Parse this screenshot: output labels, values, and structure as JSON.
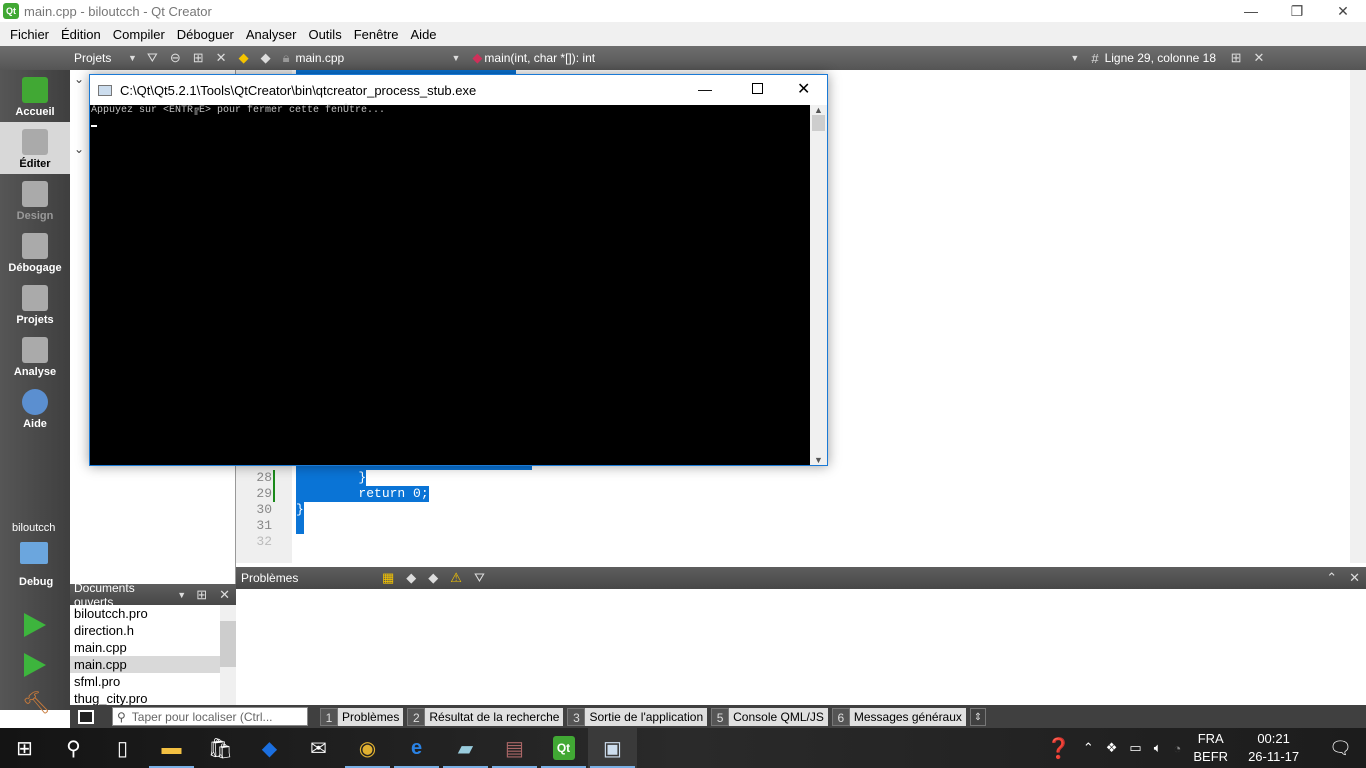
{
  "window": {
    "title": "main.cpp - biloutcch - Qt Creator",
    "minimize": "—",
    "restore": "❐",
    "close": "✕"
  },
  "menu": [
    "Fichier",
    "Édition",
    "Compiler",
    "Déboguer",
    "Analyser",
    "Outils",
    "Fenêtre",
    "Aide"
  ],
  "toolbar": {
    "projects_label": "Projets",
    "file": "main.cpp",
    "symbol": "main(int, char *[]): int",
    "position": "Ligne 29, colonne 18"
  },
  "modes": [
    {
      "label": "Accueil",
      "icon": "qt-logo-icon"
    },
    {
      "label": "Éditer",
      "icon": "edit-icon"
    },
    {
      "label": "Design",
      "icon": "design-icon"
    },
    {
      "label": "Débogage",
      "icon": "debug-icon"
    },
    {
      "label": "Projets",
      "icon": "projects-icon"
    },
    {
      "label": "Analyse",
      "icon": "analyze-icon"
    },
    {
      "label": "Aide",
      "icon": "help-icon"
    }
  ],
  "kit": {
    "project": "biloutcch",
    "config": "Debug"
  },
  "editor": {
    "lines": [
      {
        "n": "28",
        "code": "        }"
      },
      {
        "n": "29",
        "code": "        return 0;"
      },
      {
        "n": "30",
        "code": "}"
      },
      {
        "n": "31",
        "code": " "
      },
      {
        "n": "32",
        "code": ""
      }
    ]
  },
  "console": {
    "title": "C:\\Qt\\Qt5.2.1\\Tools\\QtCreator\\bin\\qtcreator_process_stub.exe",
    "text": "Appuyez sur <ENTR╔E> pour fermer cette fenÛtre..."
  },
  "open_docs": {
    "title": "Documents ouverts",
    "items": [
      "biloutcch.pro",
      "direction.h",
      "main.cpp",
      "main.cpp",
      "sfml.pro",
      "thug_city.pro"
    ],
    "selected": 3
  },
  "problems": {
    "title": "Problèmes"
  },
  "statusbar": {
    "search_placeholder": "Taper pour localiser (Ctrl...",
    "tabs": [
      {
        "n": "1",
        "label": "Problèmes"
      },
      {
        "n": "2",
        "label": "Résultat de la recherche"
      },
      {
        "n": "3",
        "label": "Sortie de l'application"
      },
      {
        "n": "5",
        "label": "Console QML/JS"
      },
      {
        "n": "6",
        "label": "Messages généraux"
      }
    ]
  },
  "taskbar": {
    "lang": "FRA",
    "layout": "BEFR",
    "time": "00:21",
    "date": "26-11-17"
  },
  "colors": {
    "selection": "#0a74d6",
    "qt_green": "#41a834"
  }
}
